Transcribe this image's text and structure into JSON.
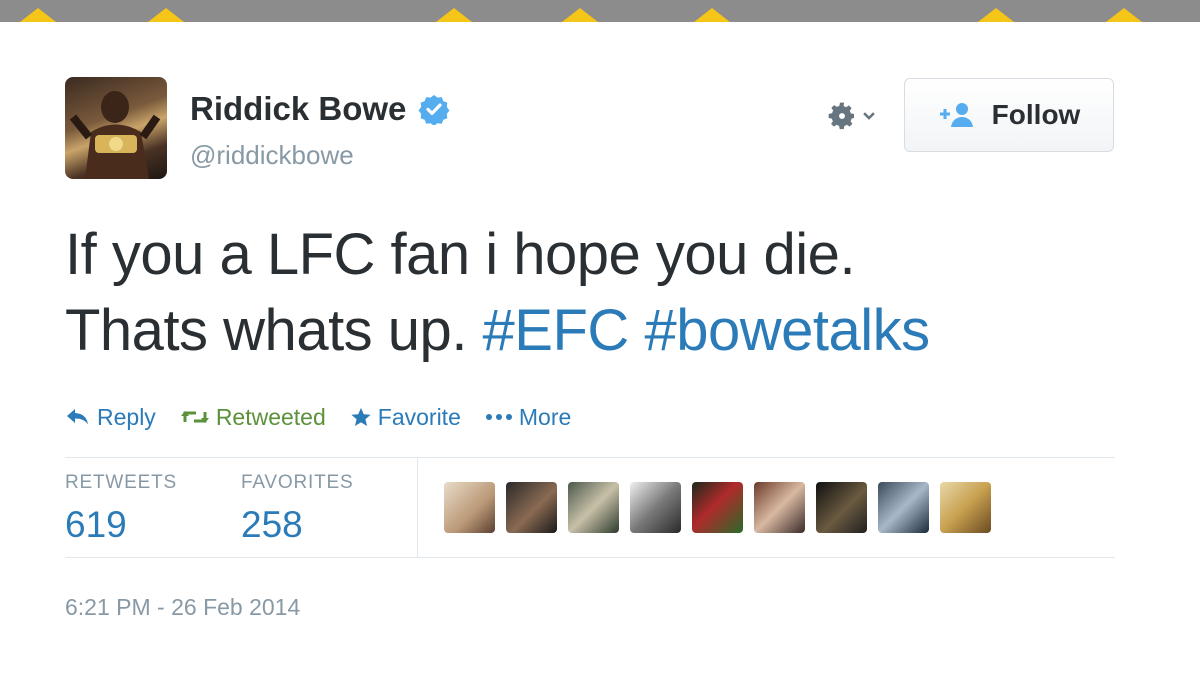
{
  "profile": {
    "name": "Riddick Bowe",
    "handle": "@riddickbowe",
    "verified": true
  },
  "header": {
    "follow_label": "Follow"
  },
  "tweet": {
    "line1": "If you a LFC fan i hope you die.",
    "line2_text": "Thats whats up. ",
    "hashtag1": "#EFC",
    "hashtag2": "#bowetalks"
  },
  "actions": {
    "reply": "Reply",
    "retweeted": "Retweeted",
    "favorite": "Favorite",
    "more": "More"
  },
  "stats": {
    "retweets_label": "RETWEETS",
    "retweets_count": "619",
    "favorites_label": "FAVORITES",
    "favorites_count": "258"
  },
  "timestamp": "6:21 PM - 26 Feb 2014",
  "colors": {
    "link": "#2b7bb9",
    "retweeted": "#5c913b",
    "muted": "#8899a6",
    "verified": "#55acee",
    "accent_bar": "#f5c518"
  },
  "icons": {
    "verified": "verified-badge-icon",
    "gear": "gear-icon",
    "follow": "add-user-icon",
    "reply": "reply-arrow-icon",
    "retweet": "retweet-icon",
    "favorite": "star-icon",
    "more": "ellipsis-icon"
  }
}
